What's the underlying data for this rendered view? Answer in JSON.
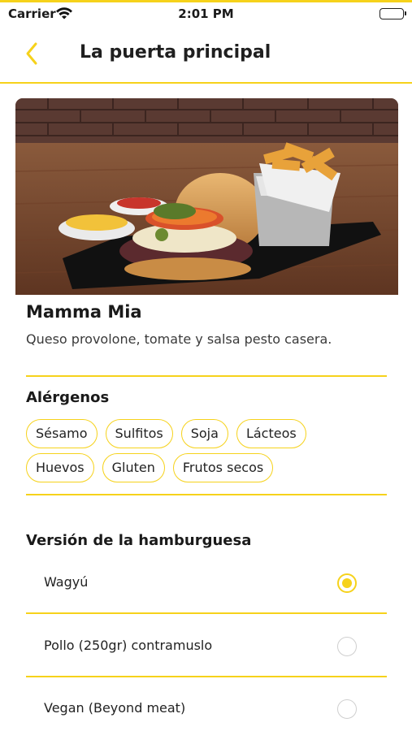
{
  "status_bar": {
    "carrier": "Carrier",
    "time": "2:01 PM"
  },
  "nav": {
    "title": "La puerta principal",
    "back_icon": "chevron-left-icon"
  },
  "product": {
    "name": "Mamma Mia",
    "description": "Queso provolone, tomate y salsa pesto casera."
  },
  "allergens": {
    "title": "Alérgenos",
    "rows": [
      [
        "Sésamo",
        "Sulfitos",
        "Soja",
        "Lácteos"
      ],
      [
        "Huevos",
        "Gluten",
        "Frutos secos"
      ]
    ]
  },
  "version": {
    "title": "Versión de la hamburguesa",
    "options": [
      {
        "label": "Wagyú",
        "selected": true
      },
      {
        "label": "Pollo (250gr) contramuslo",
        "selected": false
      },
      {
        "label": "Vegan (Beyond meat)",
        "selected": false
      }
    ]
  },
  "colors": {
    "accent": "#f6d21b",
    "text": "#1a1a1a"
  }
}
